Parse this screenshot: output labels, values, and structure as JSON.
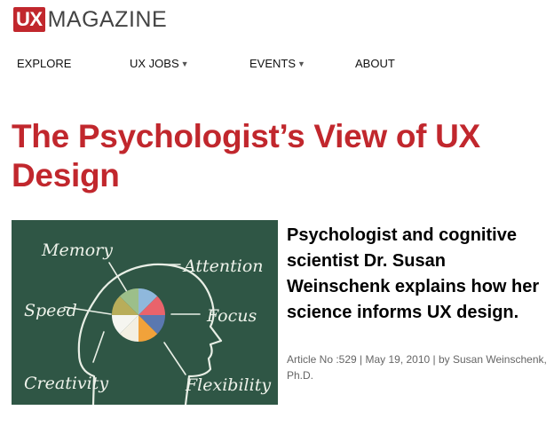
{
  "logo": {
    "mark": "UX",
    "word": "MAGAZINE",
    "brand_color": "#c1272d"
  },
  "nav": [
    {
      "label": "EXPLORE",
      "has_dropdown": false
    },
    {
      "label": "UX JOBS",
      "has_dropdown": true
    },
    {
      "label": "EVENTS",
      "has_dropdown": true
    },
    {
      "label": "ABOUT",
      "has_dropdown": false
    }
  ],
  "article": {
    "title": "The Psychologist’s View of UX Design",
    "summary": "Psychologist and cognitive scientist Dr. Susan Weinschenk explains how her science informs UX design.",
    "meta": "Article No :529 | May 19, 2010 | by Susan Weinschenk, Ph.D.",
    "image": {
      "icon": "chalkboard-brain-illustration",
      "labels": [
        "Memory",
        "Attention",
        "Speed",
        "Focus",
        "Creativity",
        "Flexibility"
      ],
      "board_color": "#2f5645"
    }
  }
}
